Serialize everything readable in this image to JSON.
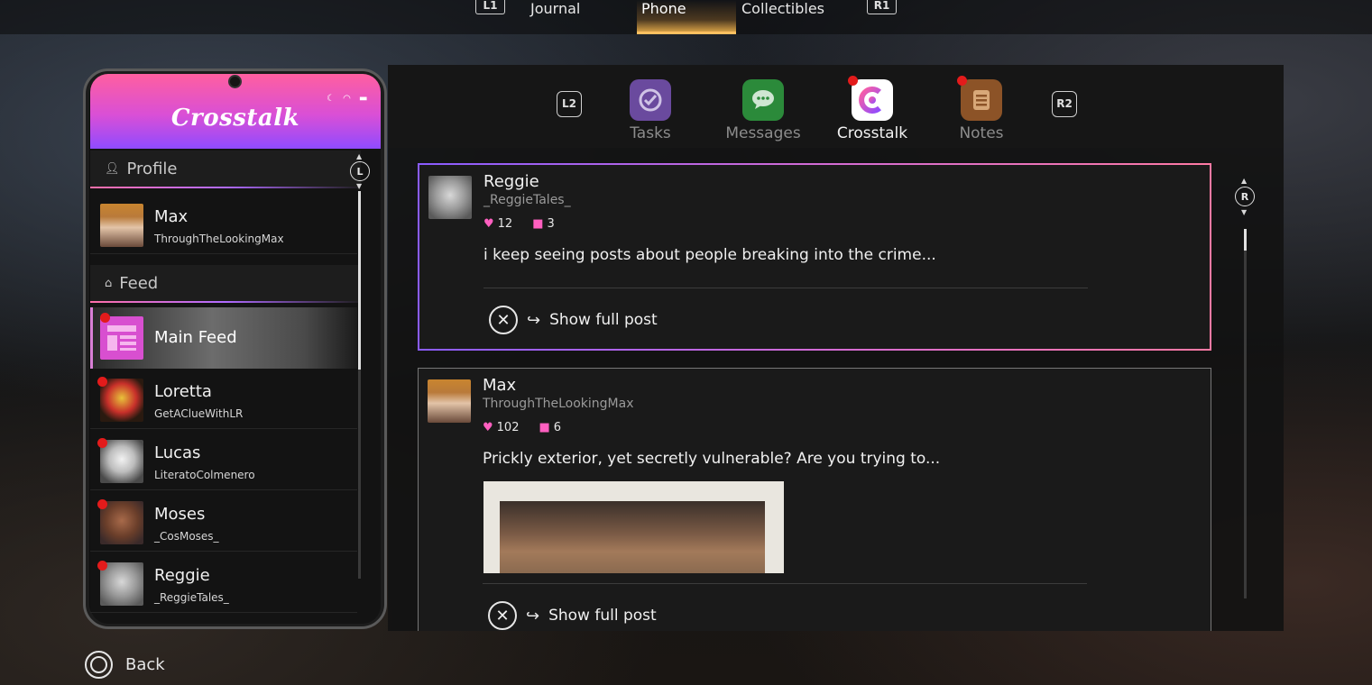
{
  "top_nav": {
    "l1": "L1",
    "r1": "R1",
    "items": [
      "Journal",
      "Phone",
      "Collectibles"
    ],
    "active": "Phone"
  },
  "apps": {
    "l2": "L2",
    "r2": "R2",
    "items": [
      {
        "label": "Tasks",
        "icon": "check-circle-icon",
        "color": "#7a55b0"
      },
      {
        "label": "Messages",
        "icon": "chat-bubble-icon",
        "color": "#2f9a3f"
      },
      {
        "label": "Crosstalk",
        "icon": "crosstalk-logo-icon",
        "color": "#d84fd0"
      },
      {
        "label": "Notes",
        "icon": "notes-icon",
        "color": "#9a5a2a"
      }
    ],
    "active": "Crosstalk"
  },
  "phone": {
    "brand": "Crosstalk",
    "left_stick": "L",
    "profile_section": "Profile",
    "profile": {
      "name": "Max",
      "handle": "ThroughTheLookingMax"
    },
    "feed_section": "Feed",
    "main_feed": "Main Feed",
    "feed_list": [
      {
        "name": "Loretta",
        "handle": "GetAClueWithLR"
      },
      {
        "name": "Lucas",
        "handle": "LiteratoColmenero"
      },
      {
        "name": "Moses",
        "handle": "_CosMoses_"
      },
      {
        "name": "Reggie",
        "handle": "_ReggieTales_"
      }
    ]
  },
  "posts": [
    {
      "name": "Reggie",
      "handle": "_ReggieTales_",
      "likes": "12",
      "comments": "3",
      "text": "i keep seeing posts about people breaking into the crime...",
      "action": "Show full post"
    },
    {
      "name": "Max",
      "handle": "ThroughTheLookingMax",
      "likes": "102",
      "comments": "6",
      "text": "Prickly exterior, yet secretly vulnerable? Are you trying to...",
      "action": "Show full post"
    }
  ],
  "right_stick": "R",
  "back_label": "Back",
  "colors": {
    "accent_pink": "#ff5fa0",
    "accent_purple": "#8f4bff",
    "unread_dot": "#e31b1b"
  }
}
